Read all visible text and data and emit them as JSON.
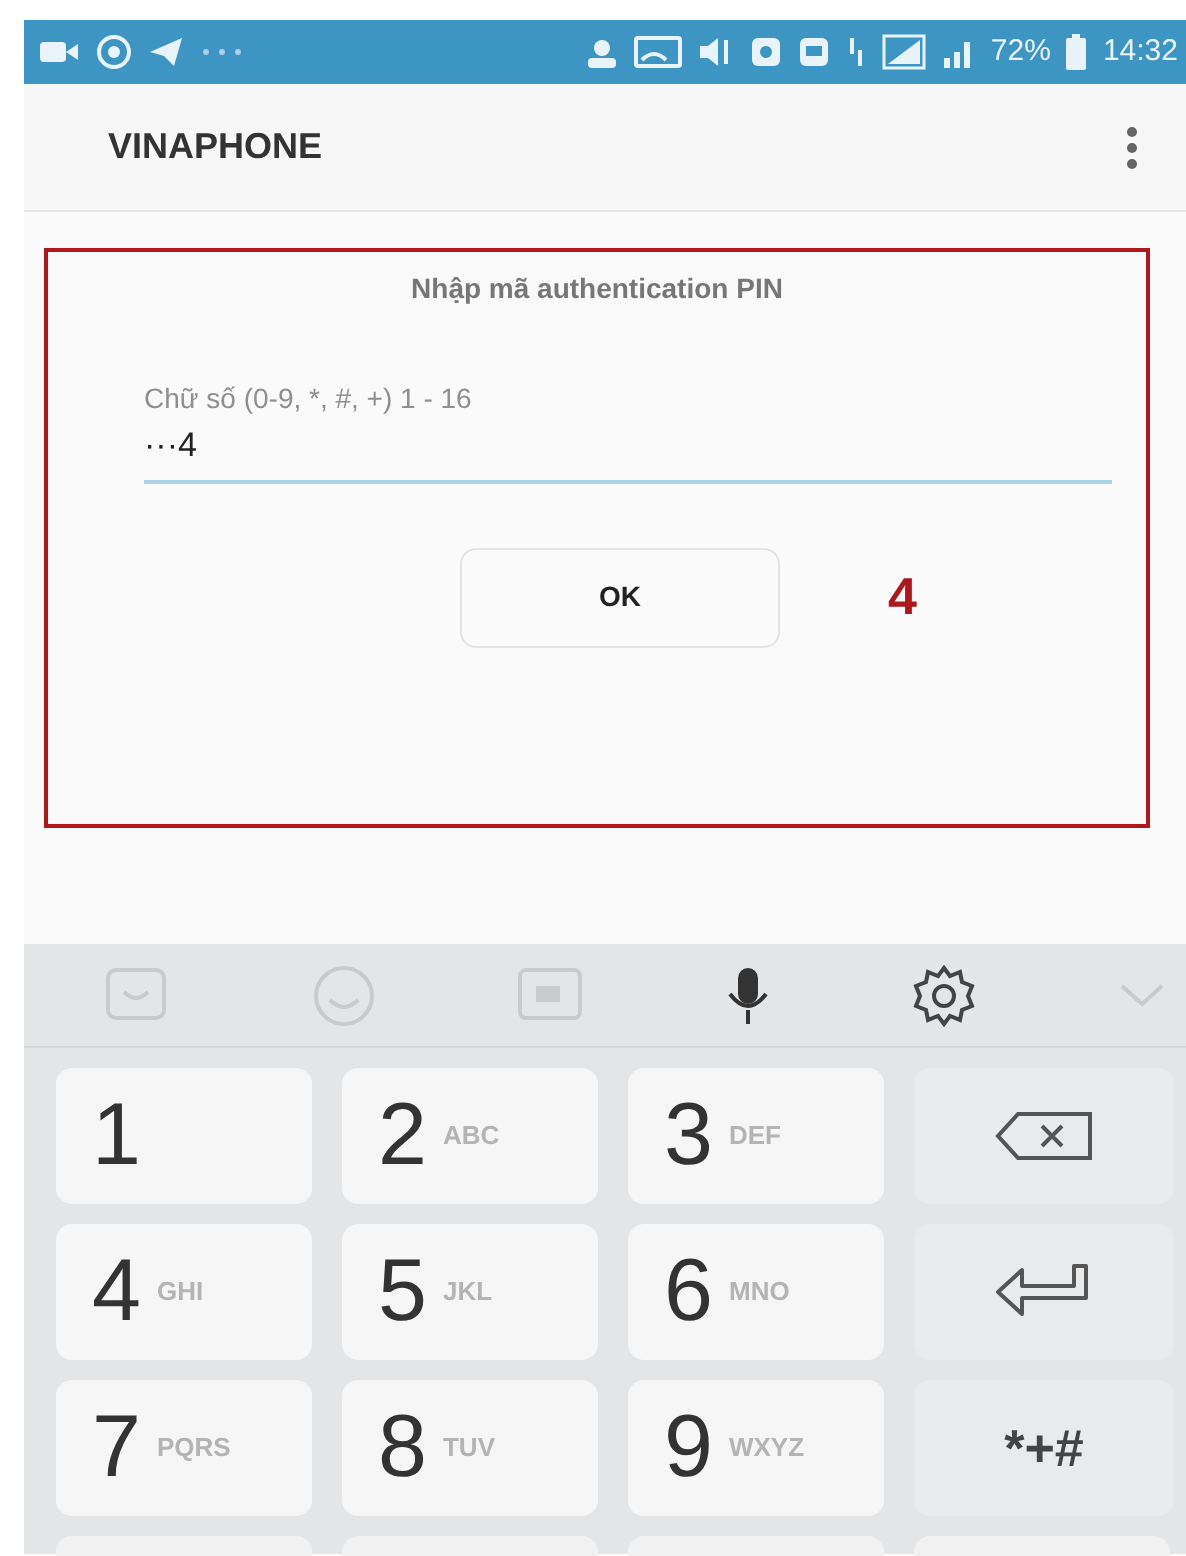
{
  "status_bar": {
    "battery": "72%",
    "time": "14:32"
  },
  "app_bar": {
    "title": "VINAPHONE"
  },
  "dialog": {
    "title": "Nhập mã authentication PIN",
    "field": {
      "label": "Chữ số (0-9, *, #, +) 1 - 16",
      "value": "···4"
    },
    "button": "OK",
    "step_number": "4"
  },
  "keyboard": {
    "rows": [
      [
        {
          "kind": "digit",
          "digit": "1"
        },
        {
          "kind": "digit",
          "digit": "2",
          "letters": "ABC"
        },
        {
          "kind": "digit",
          "digit": "3",
          "letters": "DEF"
        },
        {
          "kind": "backspace"
        }
      ],
      [
        {
          "kind": "digit",
          "digit": "4",
          "letters": "GHI"
        },
        {
          "kind": "digit",
          "digit": "5",
          "letters": "JKL"
        },
        {
          "kind": "digit",
          "digit": "6",
          "letters": "MNO"
        },
        {
          "kind": "enter"
        }
      ],
      [
        {
          "kind": "digit",
          "digit": "7",
          "letters": "PQRS"
        },
        {
          "kind": "digit",
          "digit": "8",
          "letters": "TUV"
        },
        {
          "kind": "digit",
          "digit": "9",
          "letters": "WXYZ"
        },
        {
          "kind": "symbols",
          "label": "*+#"
        }
      ]
    ]
  }
}
